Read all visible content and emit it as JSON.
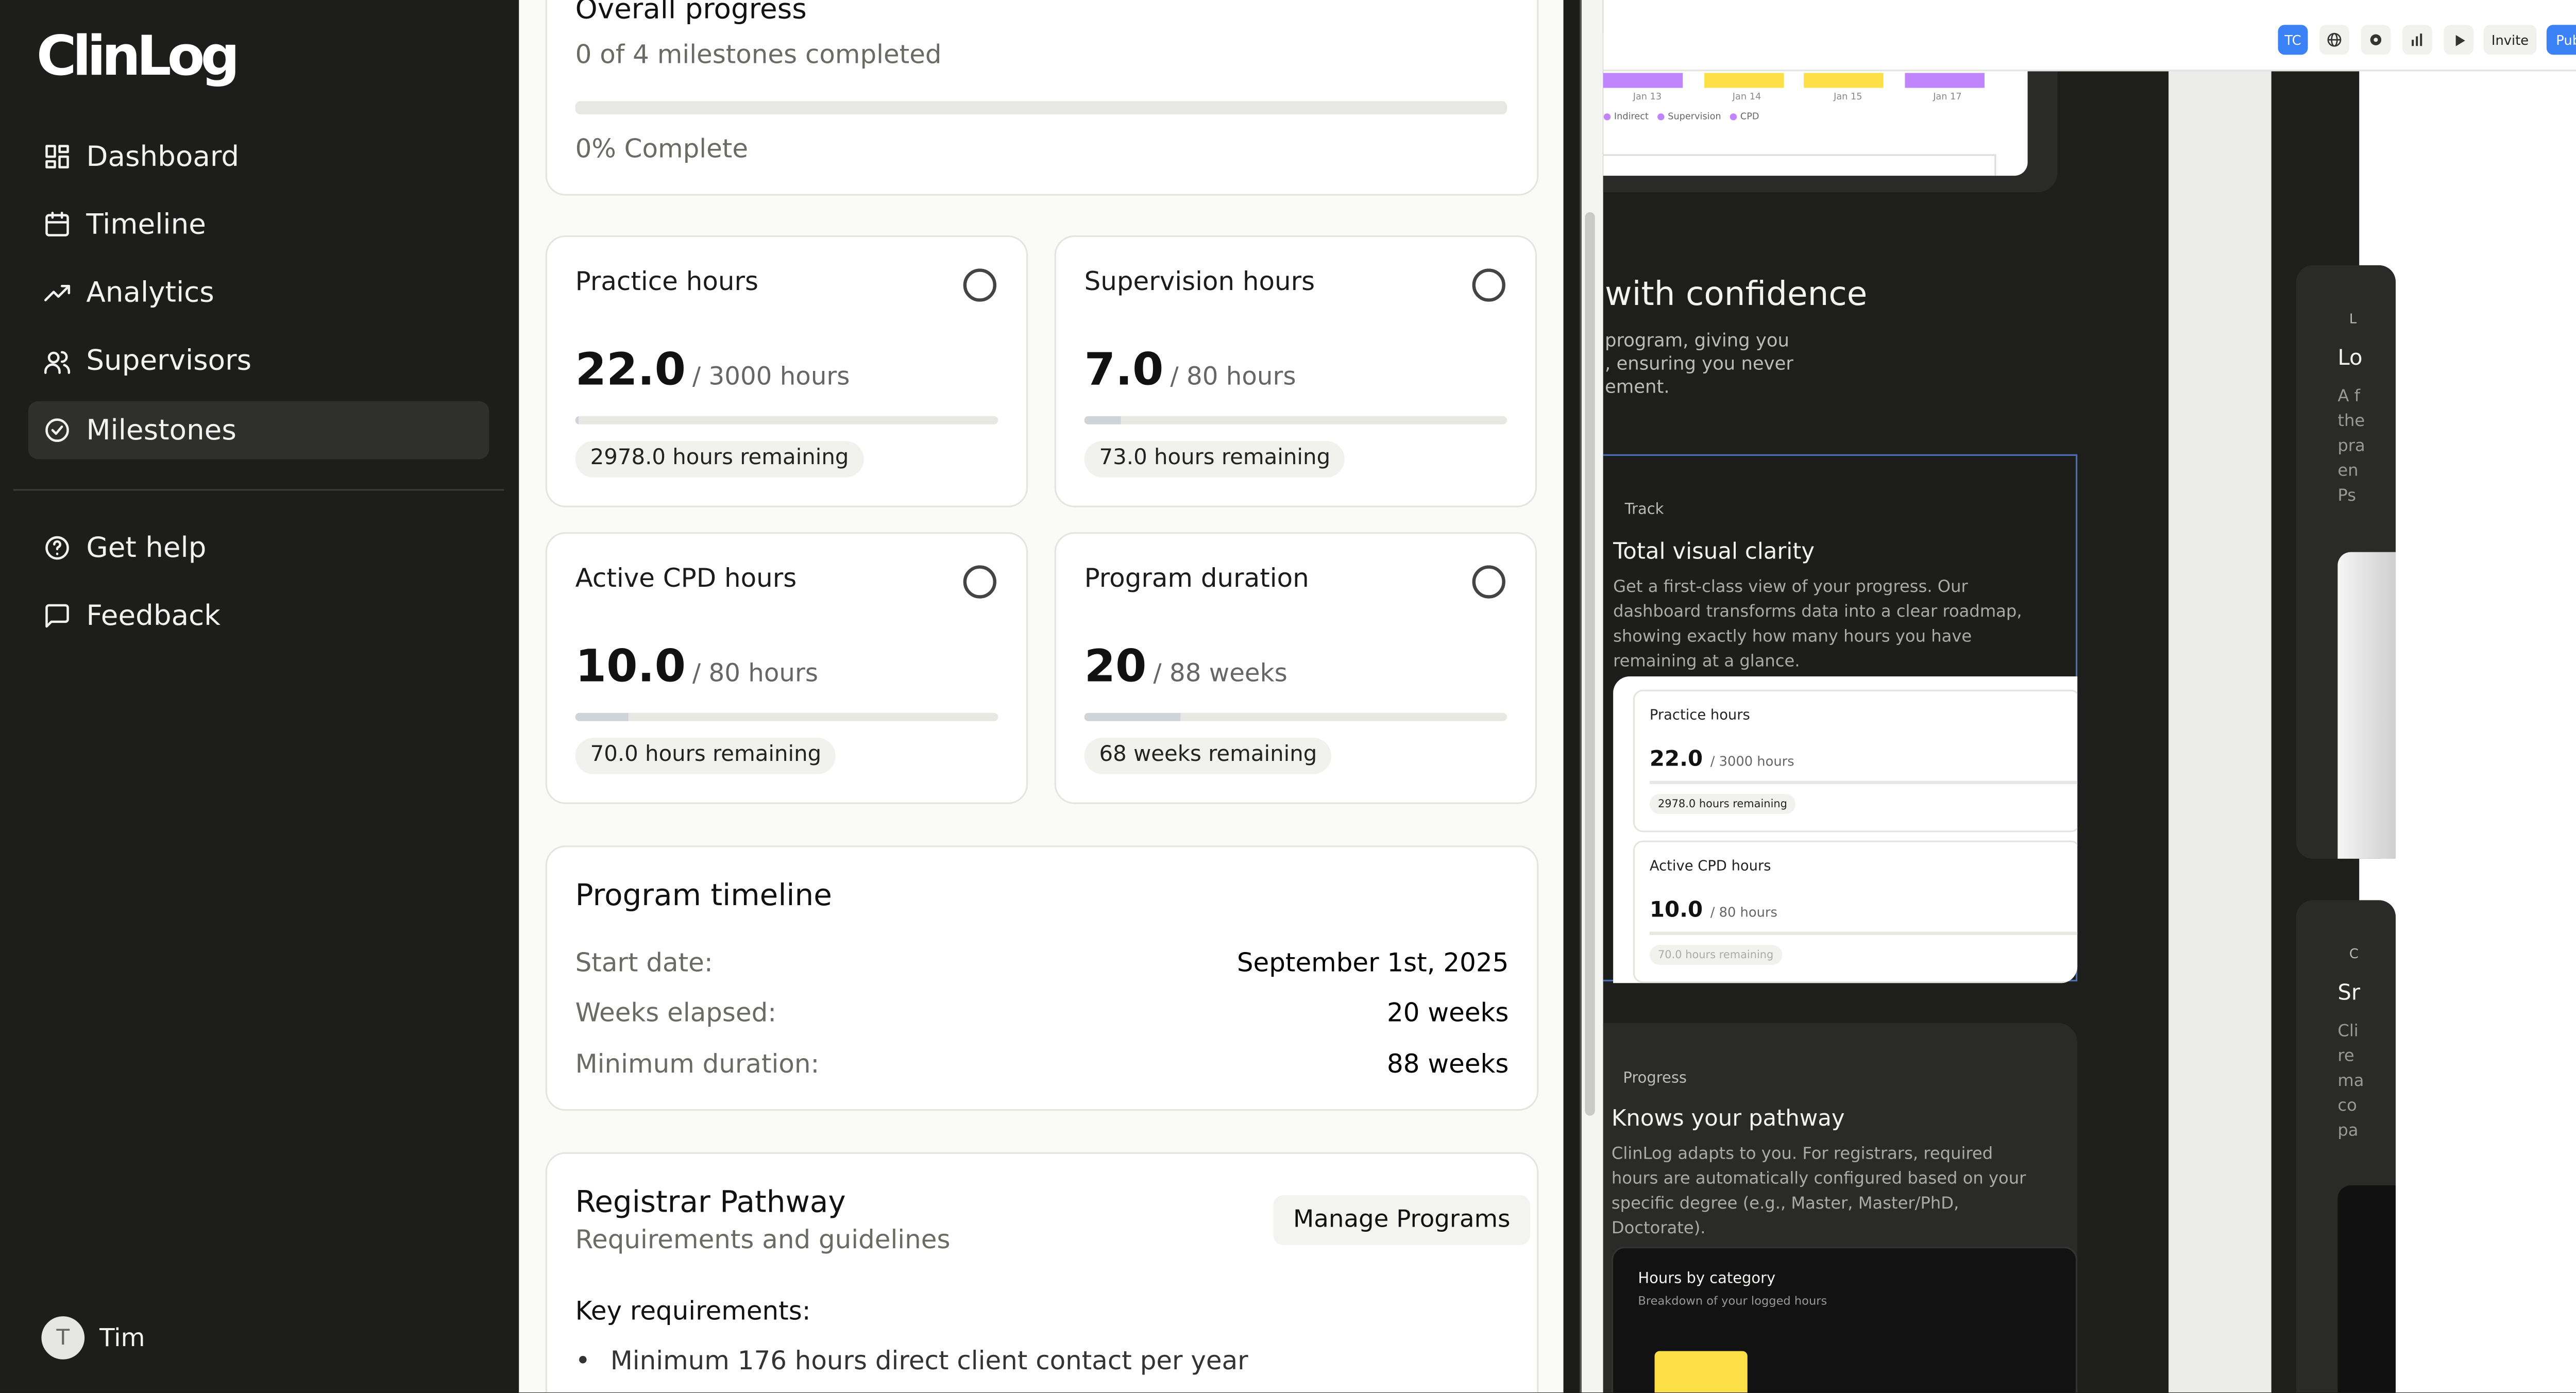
{
  "app": {
    "logo": "ClinLog"
  },
  "sidebar": {
    "items": [
      {
        "label": "Dashboard",
        "icon": "dashboard-icon"
      },
      {
        "label": "Timeline",
        "icon": "calendar-icon"
      },
      {
        "label": "Analytics",
        "icon": "trend-icon"
      },
      {
        "label": "Supervisors",
        "icon": "users-icon"
      },
      {
        "label": "Milestones",
        "icon": "check-circle-icon",
        "active": true
      }
    ],
    "secondary": [
      {
        "label": "Get help",
        "icon": "help-icon"
      },
      {
        "label": "Feedback",
        "icon": "message-icon"
      }
    ],
    "user": {
      "initial": "T",
      "name": "Tim"
    }
  },
  "overall": {
    "title": "Overall progress",
    "subtitle": "0 of 4 milestones completed",
    "percent_label": "0% Complete",
    "progress": 0
  },
  "metrics": [
    {
      "title": "Practice hours",
      "value": "22.0",
      "total": "/ 3000 hours",
      "remaining": "2978.0 hours remaining",
      "progress": 0.0073
    },
    {
      "title": "Supervision hours",
      "value": "7.0",
      "total": "/ 80 hours",
      "remaining": "73.0 hours remaining",
      "progress": 0.0875
    },
    {
      "title": "Active CPD hours",
      "value": "10.0",
      "total": "/ 80 hours",
      "remaining": "70.0 hours remaining",
      "progress": 0.125
    },
    {
      "title": "Program duration",
      "value": "20",
      "total": "/ 88 weeks",
      "remaining": "68 weeks remaining",
      "progress": 0.227
    }
  ],
  "timeline": {
    "title": "Program timeline",
    "rows": [
      {
        "label": "Start date:",
        "value": "September 1st, 2025"
      },
      {
        "label": "Weeks elapsed:",
        "value": "20 weeks"
      },
      {
        "label": "Minimum duration:",
        "value": "88 weeks"
      }
    ]
  },
  "pathway": {
    "title": "Registrar Pathway",
    "subtitle": "Requirements and guidelines",
    "button": "Manage Programs",
    "key_label": "Key requirements:",
    "bullets": [
      "Minimum 176 hours direct client contact per year"
    ]
  },
  "preview": {
    "toolbar": {
      "avatar": "TC",
      "invite": "Invite",
      "publish": "Publish"
    },
    "chart_ticks": [
      "Jan 13",
      "Jan 14",
      "Jan 15",
      "Jan 17"
    ],
    "legend": [
      "Indirect",
      "Supervision",
      "CPD"
    ],
    "headline": "with confidence",
    "headline_text": "program, giving you\n, ensuring you never\nement.",
    "track": {
      "eyebrow": "Track",
      "title": "Total visual clarity",
      "text": "Get a first-class view of your progress. Our dashboard transforms data into a clear roadmap, showing exactly how many hours you have remaining at a glance.",
      "mini": [
        {
          "title": "Practice hours",
          "value": "22.0",
          "total": "/ 3000 hours",
          "remaining": "2978.0 hours remaining"
        },
        {
          "title": "Active CPD hours",
          "value": "10.0",
          "total": "/ 80 hours",
          "remaining": "70.0 hours remaining"
        }
      ]
    },
    "progress_card": {
      "eyebrow": "Progress",
      "title": "Knows your pathway",
      "text": "ClinLog adapts to you. For registrars, required hours are automatically configured based on your specific degree (e.g., Master, Master/PhD, Doctorate).",
      "chart_title": "Hours by category",
      "chart_sub": "Breakdown of your logged hours"
    },
    "right_fragments": {
      "a": "L",
      "b": "Lo",
      "c": "A f\nthe\npra\nen\nPs",
      "d": "C",
      "e": "Sr",
      "f": "Cli\nre\nma\nco\npa"
    }
  },
  "colors": {
    "accent_blue": "#3b82f6",
    "bar_purple": "#c084fc",
    "bar_yellow": "#fde047"
  }
}
